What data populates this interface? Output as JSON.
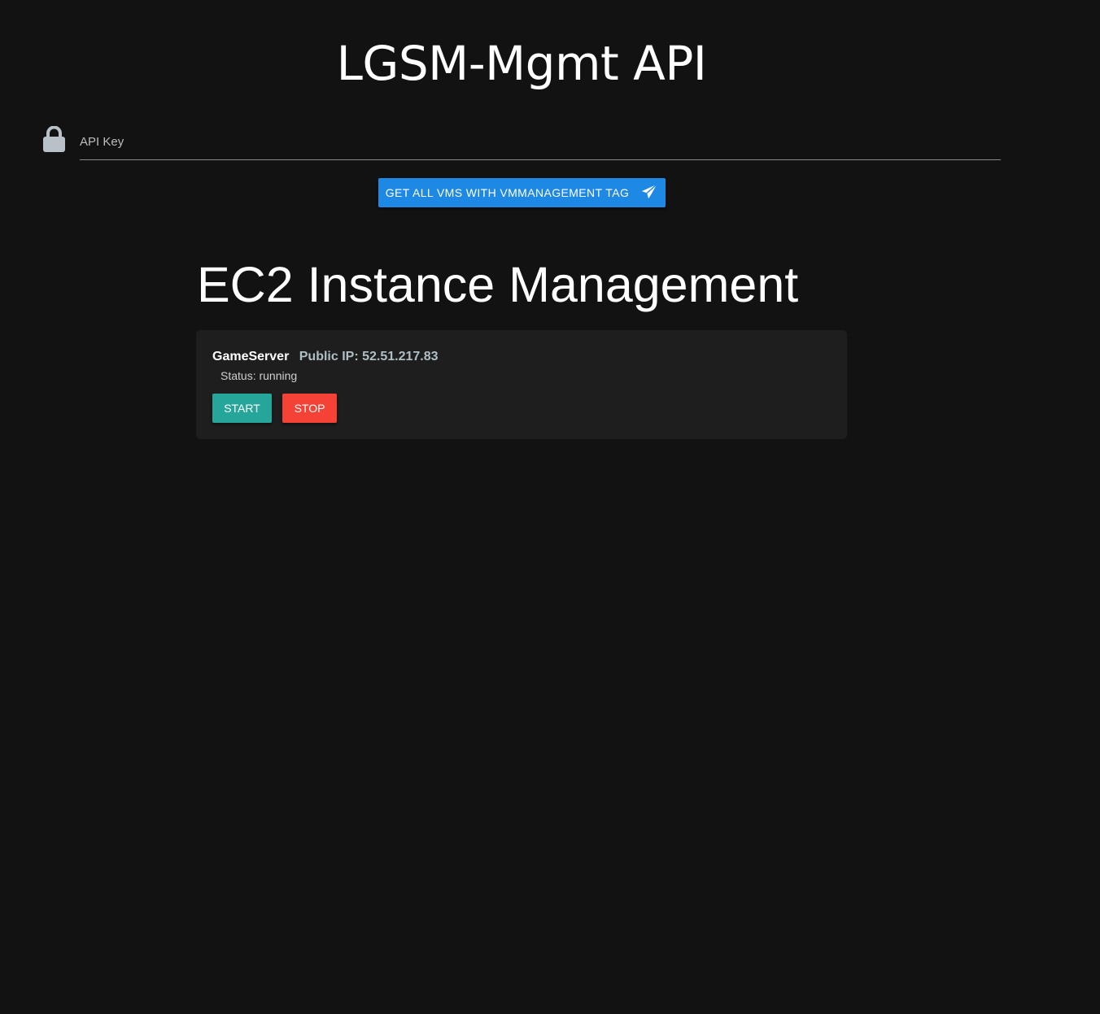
{
  "header": {
    "title": "LGSM-Mgmt API"
  },
  "api_key": {
    "placeholder": "API Key",
    "value": "",
    "icon": "lock-icon"
  },
  "actions": {
    "fetch_label": "GET ALL VMS WITH VMMANAGEMENT TAG",
    "fetch_icon": "send-icon"
  },
  "main": {
    "section_title": "EC2 Instance Management",
    "instances": [
      {
        "name": "GameServer",
        "public_ip": "Public IP: 52.51.217.83",
        "status": "Status: running",
        "start_label": "START",
        "stop_label": "STOP"
      }
    ]
  },
  "colors": {
    "background": "#121212",
    "primary": "#1e88e5",
    "start": "#26a69a",
    "stop": "#f44336",
    "card": "#1e1e1e"
  }
}
